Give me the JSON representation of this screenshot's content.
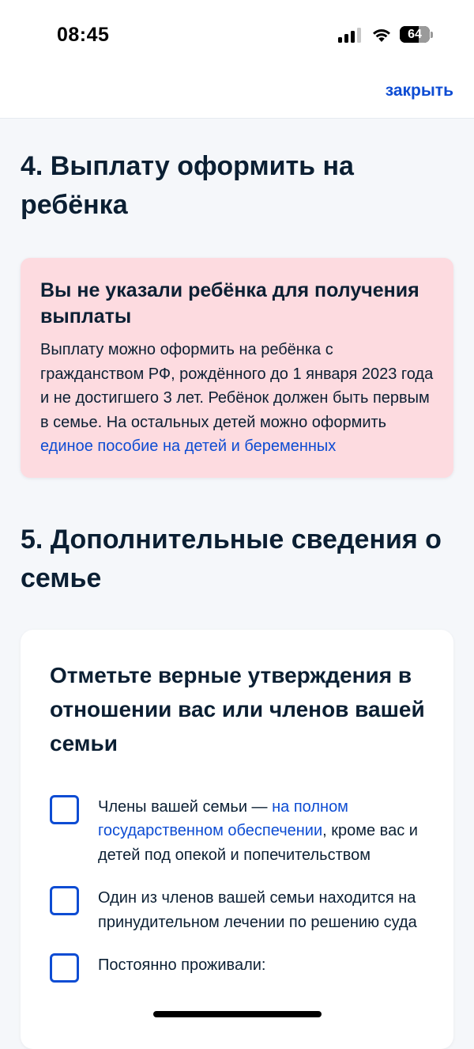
{
  "status_bar": {
    "time": "08:45",
    "battery": "64",
    "icons": [
      "cellular-signal-icon",
      "wifi-icon",
      "battery-icon"
    ]
  },
  "nav": {
    "close_label": "закрыть"
  },
  "section4": {
    "title": "4. Выплату оформить на ребёнка",
    "alert": {
      "title": "Вы не указали ребёнка для получения выплаты",
      "text_before_link": "Выплату можно оформить на ребёнка с гражданством РФ, рождённого до 1 января 2023 года и не достигшего 3 лет. Ребёнок должен быть первым в семье. На остальных детей можно оформить ",
      "link": "единое пособие на детей и беременных"
    }
  },
  "section5": {
    "title": "5. Дополнительные сведения о семье",
    "card_title": "Отметьте верные утверждения в отношении вас или членов вашей семьи",
    "items": [
      {
        "before": "Члены вашей семьи — ",
        "link": "на полном государственном обеспечении",
        "after": ", кроме вас и детей под опекой и попечительством",
        "checked": false
      },
      {
        "before": "Один из членов вашей семьи находится на принудительном лечении по решению суда",
        "link": "",
        "after": "",
        "checked": false
      },
      {
        "before": "Постоянно проживали:",
        "link": "",
        "after": "",
        "checked": false
      }
    ]
  },
  "colors": {
    "accent": "#0d4cd3",
    "alert_bg": "#fddbe0",
    "text": "#0b1f33",
    "page_bg": "#f5f7fa"
  }
}
